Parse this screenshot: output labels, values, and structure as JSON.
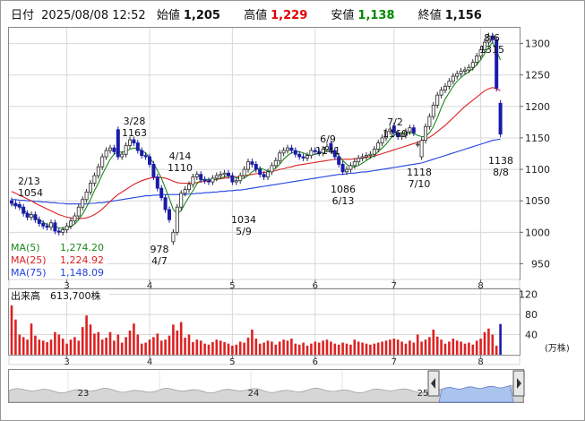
{
  "header": {
    "date_label": "日付",
    "datetime": "2025/08/08 12:52",
    "open_label": "始値",
    "open": "1,205",
    "high_label": "高値",
    "high": "1,229",
    "low_label": "安値",
    "low": "1,138",
    "close_label": "終値",
    "close": "1,156"
  },
  "colors": {
    "up": "#2a2a2a",
    "down": "#1a1aaa",
    "ma5": "#1a8a1a",
    "ma25": "#dd2222",
    "ma75": "#2244dd",
    "volume": "#dd2222",
    "high_text": "#dd0000",
    "low_text": "#008800",
    "nav_fill": "#aac4ee"
  },
  "legend": {
    "ma5": "MA(5)",
    "ma5_value": "1,274.20",
    "ma25": "MA(25)",
    "ma25_value": "1,224.92",
    "ma75": "MA(75)",
    "ma75_value": "1,148.09"
  },
  "volume_panel": {
    "label": "出来高",
    "value": "613,700株",
    "unit": "(万株)"
  },
  "chart_data": [
    {
      "type": "candlestick",
      "title": "",
      "x_ticks": [
        "3",
        "4",
        "5",
        "6",
        "7",
        "8"
      ],
      "y_ticks": [
        950,
        1000,
        1050,
        1100,
        1150,
        1200,
        1250,
        1300
      ],
      "ylim": [
        925,
        1325
      ],
      "grid": true,
      "legend_position": "bottom-left",
      "annotations": [
        {
          "date": "2/13",
          "value": 1054
        },
        {
          "date": "3/28",
          "value": 1163
        },
        {
          "date": "4/7",
          "value": 978
        },
        {
          "date": "4/14",
          "value": 1110
        },
        {
          "date": "5/9",
          "value": 1034
        },
        {
          "date": "6/9",
          "value": 1141
        },
        {
          "date": "6/13",
          "value": 1086
        },
        {
          "date": "7/2",
          "value": 1169
        },
        {
          "date": "7/10",
          "value": 1118
        },
        {
          "date": "8/6",
          "value": 1315
        },
        {
          "date": "8/8",
          "value": 1138
        }
      ],
      "close": [
        1046,
        1042,
        1040,
        1030,
        1024,
        1028,
        1020,
        1014,
        1010,
        1008,
        1015,
        1002,
        1000,
        1004,
        1010,
        1018,
        1026,
        1040,
        1052,
        1064,
        1078,
        1090,
        1104,
        1120,
        1130,
        1134,
        1128,
        1120,
        1124,
        1138,
        1147,
        1142,
        1130,
        1122,
        1120,
        1108,
        1088,
        1070,
        1055,
        1036,
        1020,
        1000,
        1040,
        1062,
        1068,
        1076,
        1088,
        1092,
        1084,
        1082,
        1080,
        1086,
        1090,
        1092,
        1094,
        1090,
        1080,
        1082,
        1090,
        1100,
        1112,
        1108,
        1100,
        1092,
        1088,
        1096,
        1106,
        1114,
        1126,
        1130,
        1134,
        1130,
        1124,
        1120,
        1118,
        1122,
        1130,
        1128,
        1126,
        1132,
        1136,
        1130,
        1120,
        1108,
        1096,
        1100,
        1106,
        1112,
        1118,
        1120,
        1122,
        1124,
        1132,
        1142,
        1150,
        1160,
        1164,
        1158,
        1152,
        1154,
        1160,
        1166,
        1158,
        1140,
        1146,
        1168,
        1184,
        1202,
        1218,
        1226,
        1232,
        1240,
        1248,
        1252,
        1256,
        1258,
        1262,
        1270,
        1280,
        1290,
        1302,
        1312,
        1306,
        1229,
        1156
      ],
      "open": [
        1050,
        1046,
        1044,
        1040,
        1030,
        1024,
        1028,
        1020,
        1014,
        1010,
        1008,
        1015,
        1002,
        1000,
        1004,
        1010,
        1018,
        1026,
        1040,
        1052,
        1064,
        1078,
        1090,
        1104,
        1120,
        1130,
        1134,
        1163,
        1120,
        1124,
        1138,
        1147,
        1142,
        1130,
        1122,
        1120,
        1108,
        1088,
        1070,
        1055,
        1036,
        985,
        1000,
        1040,
        1062,
        1068,
        1076,
        1088,
        1092,
        1084,
        1082,
        1080,
        1086,
        1090,
        1092,
        1094,
        1090,
        1080,
        1082,
        1090,
        1100,
        1112,
        1108,
        1100,
        1092,
        1088,
        1096,
        1106,
        1114,
        1126,
        1130,
        1134,
        1130,
        1124,
        1120,
        1118,
        1122,
        1130,
        1128,
        1126,
        1132,
        1141,
        1130,
        1120,
        1108,
        1096,
        1100,
        1106,
        1112,
        1118,
        1120,
        1122,
        1124,
        1132,
        1142,
        1150,
        1160,
        1169,
        1158,
        1152,
        1154,
        1160,
        1166,
        1140,
        1120,
        1146,
        1168,
        1184,
        1202,
        1218,
        1226,
        1232,
        1240,
        1248,
        1252,
        1256,
        1258,
        1262,
        1270,
        1280,
        1290,
        1302,
        1312,
        1306,
        1205
      ],
      "ma5": [
        1044,
        1043,
        1041,
        1036,
        1030,
        1027,
        1024,
        1020,
        1016,
        1012,
        1011,
        1009,
        1007,
        1006,
        1007,
        1009,
        1013,
        1020,
        1029,
        1040,
        1052,
        1066,
        1078,
        1092,
        1104,
        1116,
        1124,
        1128,
        1127,
        1129,
        1132,
        1134,
        1133,
        1130,
        1126,
        1119,
        1110,
        1098,
        1086,
        1070,
        1054,
        1036,
        1030,
        1034,
        1046,
        1056,
        1066,
        1077,
        1083,
        1084,
        1084,
        1084,
        1084,
        1086,
        1088,
        1090,
        1089,
        1087,
        1085,
        1086,
        1090,
        1096,
        1100,
        1102,
        1100,
        1097,
        1098,
        1102,
        1108,
        1116,
        1122,
        1126,
        1128,
        1128,
        1126,
        1123,
        1123,
        1124,
        1125,
        1127,
        1130,
        1130,
        1128,
        1122,
        1114,
        1108,
        1104,
        1104,
        1106,
        1110,
        1114,
        1118,
        1122,
        1128,
        1134,
        1140,
        1148,
        1154,
        1157,
        1158,
        1158,
        1158,
        1157,
        1154,
        1152,
        1152,
        1158,
        1168,
        1182,
        1198,
        1212,
        1222,
        1232,
        1240,
        1246,
        1251,
        1255,
        1260,
        1266,
        1274,
        1284,
        1294,
        1302,
        1288,
        1274
      ],
      "ma25": [
        1065,
        1062,
        1059,
        1056,
        1053,
        1050,
        1046,
        1043,
        1040,
        1037,
        1034,
        1031,
        1028,
        1026,
        1024,
        1023,
        1022,
        1022,
        1022,
        1023,
        1025,
        1028,
        1032,
        1037,
        1043,
        1049,
        1055,
        1060,
        1064,
        1068,
        1072,
        1076,
        1079,
        1082,
        1084,
        1086,
        1087,
        1087,
        1087,
        1086,
        1084,
        1081,
        1079,
        1078,
        1078,
        1078,
        1078,
        1079,
        1080,
        1081,
        1082,
        1083,
        1084,
        1085,
        1086,
        1087,
        1088,
        1088,
        1089,
        1090,
        1091,
        1092,
        1093,
        1094,
        1095,
        1096,
        1097,
        1098,
        1100,
        1101,
        1103,
        1104,
        1106,
        1107,
        1108,
        1109,
        1110,
        1111,
        1112,
        1113,
        1114,
        1115,
        1116,
        1116,
        1116,
        1116,
        1116,
        1117,
        1117,
        1118,
        1119,
        1120,
        1121,
        1123,
        1125,
        1127,
        1129,
        1131,
        1133,
        1135,
        1137,
        1139,
        1141,
        1143,
        1145,
        1148,
        1151,
        1155,
        1160,
        1165,
        1170,
        1176,
        1182,
        1188,
        1194,
        1200,
        1205,
        1210,
        1215,
        1220,
        1225,
        1228,
        1230,
        1228,
        1225
      ],
      "ma75": [
        1052,
        1052,
        1051,
        1051,
        1050,
        1050,
        1049,
        1049,
        1048,
        1048,
        1047,
        1047,
        1046,
        1046,
        1045,
        1045,
        1045,
        1045,
        1045,
        1045,
        1046,
        1046,
        1047,
        1047,
        1048,
        1049,
        1050,
        1051,
        1052,
        1053,
        1054,
        1055,
        1056,
        1057,
        1058,
        1058,
        1059,
        1059,
        1060,
        1060,
        1060,
        1060,
        1060,
        1060,
        1060,
        1061,
        1061,
        1062,
        1062,
        1063,
        1063,
        1064,
        1064,
        1065,
        1065,
        1066,
        1066,
        1067,
        1067,
        1068,
        1069,
        1070,
        1071,
        1072,
        1073,
        1074,
        1075,
        1076,
        1077,
        1078,
        1079,
        1080,
        1081,
        1082,
        1083,
        1084,
        1085,
        1086,
        1087,
        1088,
        1089,
        1090,
        1091,
        1092,
        1092,
        1093,
        1094,
        1094,
        1095,
        1096,
        1096,
        1097,
        1098,
        1099,
        1100,
        1101,
        1102,
        1103,
        1104,
        1105,
        1106,
        1107,
        1108,
        1109,
        1110,
        1112,
        1114,
        1116,
        1118,
        1120,
        1122,
        1124,
        1126,
        1128,
        1130,
        1132,
        1134,
        1136,
        1138,
        1140,
        1142,
        1144,
        1146,
        1147,
        1148
      ]
    },
    {
      "type": "bar",
      "title": "出来高",
      "y_ticks": [
        40,
        80,
        120
      ],
      "ylim": [
        0,
        130
      ],
      "unit": "万株",
      "values": [
        98,
        70,
        40,
        35,
        30,
        62,
        38,
        30,
        28,
        25,
        30,
        45,
        40,
        32,
        22,
        30,
        35,
        28,
        55,
        78,
        60,
        42,
        45,
        30,
        34,
        45,
        28,
        40,
        24,
        35,
        48,
        62,
        40,
        22,
        24,
        30,
        35,
        42,
        28,
        30,
        38,
        60,
        48,
        65,
        34,
        40,
        25,
        30,
        28,
        22,
        20,
        25,
        30,
        28,
        25,
        22,
        18,
        20,
        26,
        24,
        34,
        50,
        32,
        22,
        24,
        28,
        26,
        20,
        26,
        30,
        28,
        32,
        22,
        20,
        24,
        18,
        22,
        26,
        24,
        28,
        30,
        26,
        22,
        20,
        24,
        22,
        20,
        30,
        26,
        24,
        22,
        20,
        22,
        24,
        26,
        28,
        30,
        32,
        30,
        26,
        22,
        28,
        24,
        40,
        26,
        30,
        35,
        50,
        36,
        30,
        22,
        26,
        32,
        28,
        26,
        22,
        24,
        20,
        28,
        32,
        45,
        52,
        40,
        18,
        61
      ]
    }
  ],
  "navigator": {
    "labels": [
      "23",
      "24",
      "25"
    ]
  }
}
